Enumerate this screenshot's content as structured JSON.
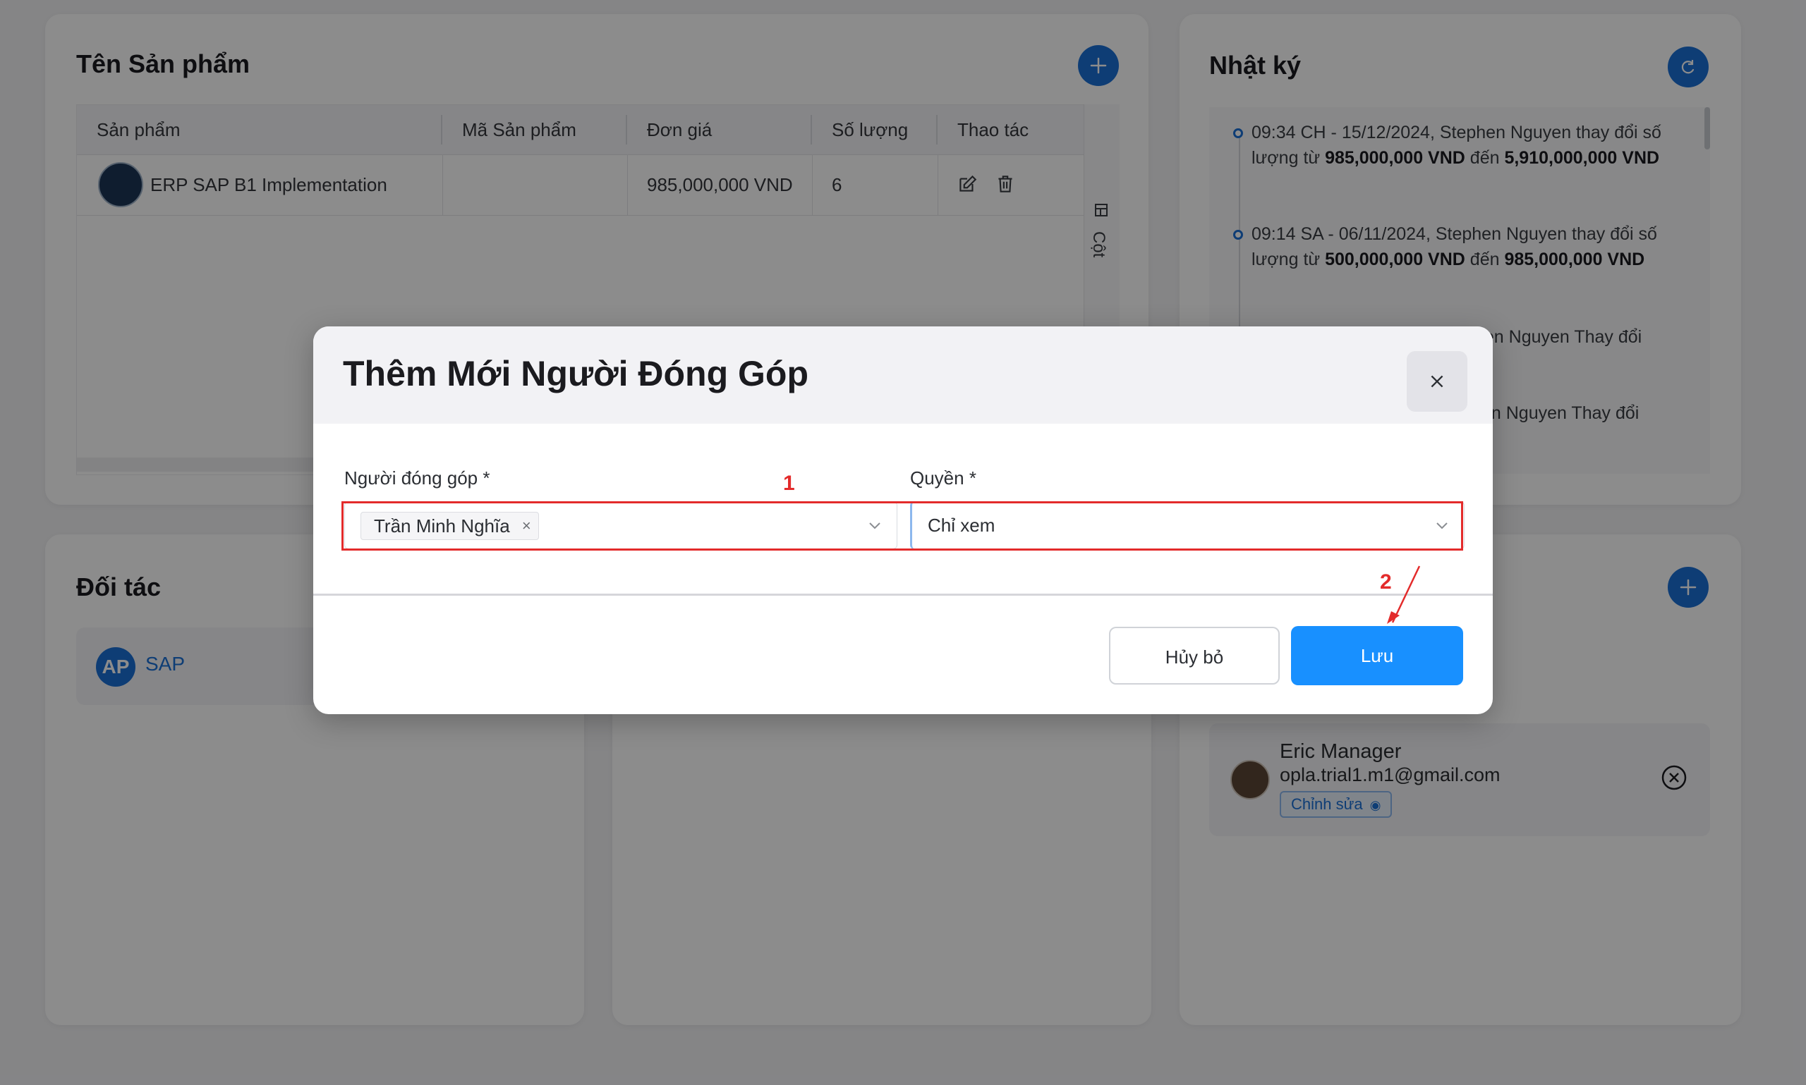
{
  "products_card": {
    "title": "Tên Sản phẩm",
    "columns": [
      "Sản phẩm",
      "Mã Sản phẩm",
      "Đơn giá",
      "Số lượng",
      "Thao tác"
    ],
    "rows": [
      {
        "name": "ERP SAP B1 Implementation",
        "code": "",
        "price": "985,000,000 VND",
        "qty": "6"
      }
    ],
    "side_label": "Cột"
  },
  "log_card": {
    "title": "Nhật ký",
    "entries": [
      {
        "text": "09:34 CH - 15/12/2024, Stephen Nguyen thay đổi số lượng từ ",
        "from": "985,000,000 VND",
        "mid": " đến ",
        "to": "5,910,000,000 VND"
      },
      {
        "text": "09:14 SA - 06/11/2024, Stephen Nguyen thay đổi số lượng từ ",
        "from": "500,000,000 VND",
        "mid": " đến ",
        "to": "985,000,000 VND"
      },
      {
        "text_partial": "hen Nguyen Thay đổi"
      },
      {
        "text_partial": "en Nguyen Thay đổi"
      }
    ]
  },
  "partner_card": {
    "title": "Đối tác",
    "partner_logo": "AP",
    "partner_name": "SAP"
  },
  "contributors_card": {
    "name": "Eric Manager",
    "email": "opla.trial1.m1@gmail.com",
    "permission": "Chỉnh sửa"
  },
  "modal": {
    "title": "Thêm Mới Người Đóng Góp",
    "contributor_label": "Người đóng góp *",
    "contributor_tag": "Trần Minh Nghĩa",
    "contributor_tag_remove": "×",
    "permission_label": "Quyền *",
    "permission_value": "Chỉ xem",
    "cancel_label": "Hủy bỏ",
    "save_label": "Lưu"
  },
  "annotations": {
    "step1": "1",
    "step2": "2"
  },
  "colors": {
    "primary": "#1890ff",
    "fab": "#1a6fd6",
    "annotation": "#e32b2b"
  }
}
